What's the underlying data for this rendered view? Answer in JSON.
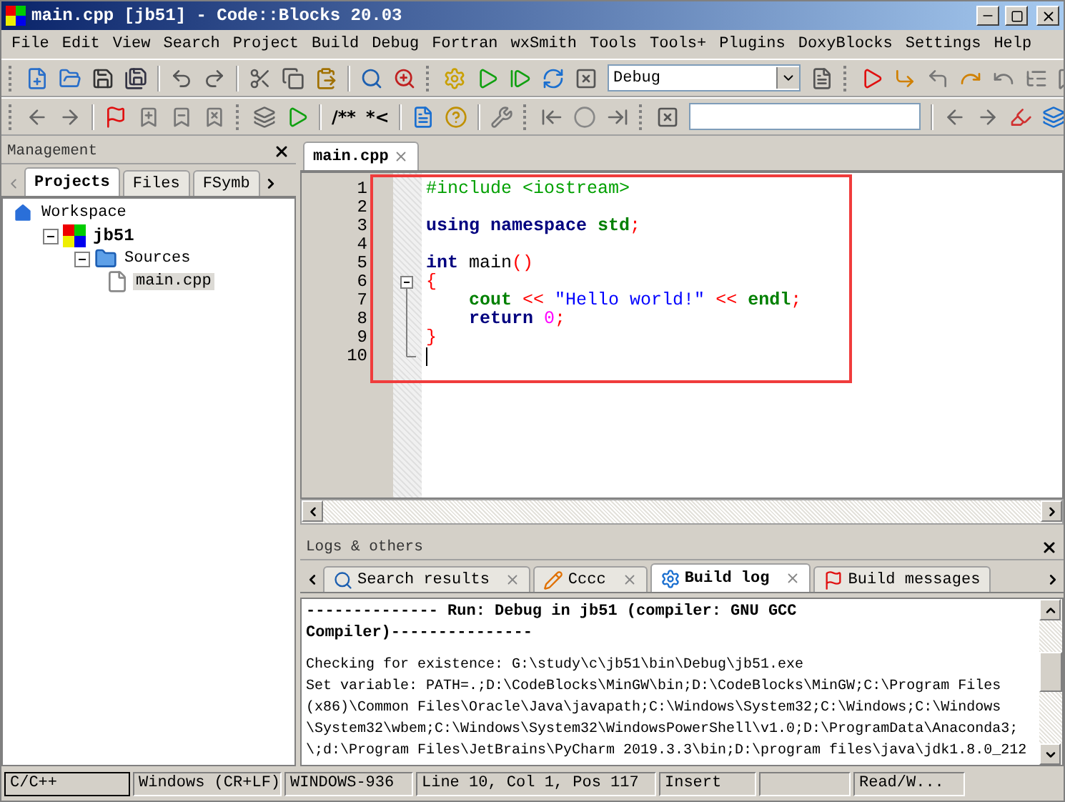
{
  "window": {
    "title": "main.cpp [jb51] - Code::Blocks 20.03"
  },
  "menu": [
    "File",
    "Edit",
    "View",
    "Search",
    "Project",
    "Build",
    "Debug",
    "Fortran",
    "wxSmith",
    "Tools",
    "Tools+",
    "Plugins",
    "DoxyBlocks",
    "Settings",
    "Help"
  ],
  "toolbar": {
    "build_target": "Debug",
    "doxy_block": "/**",
    "doxy_inline": "*<"
  },
  "management": {
    "title": "Management",
    "tabs": [
      {
        "label": "Projects",
        "selected": true
      },
      {
        "label": "Files",
        "selected": false
      },
      {
        "label": "FSymb",
        "selected": false
      }
    ],
    "tree": [
      {
        "label": "Workspace",
        "kind": "workspace",
        "expanded": true,
        "selected": false,
        "children": [
          {
            "label": "jb51",
            "kind": "project",
            "expanded": true,
            "selected": false,
            "children": [
              {
                "label": "Sources",
                "kind": "folder",
                "expanded": true,
                "selected": false,
                "children": [
                  {
                    "label": "main.cpp",
                    "kind": "file",
                    "selected": true
                  }
                ]
              }
            ]
          }
        ]
      }
    ]
  },
  "editor": {
    "tabs": [
      {
        "label": "main.cpp",
        "selected": true
      }
    ],
    "lines": [
      {
        "number": "1",
        "tokens": [
          {
            "kind": "preprocessor",
            "text": "#include <iostream>"
          }
        ]
      },
      {
        "number": "2"
      },
      {
        "number": "3",
        "tokens": [
          {
            "kind": "keyword",
            "text": "using"
          },
          {
            "kind": "keyword",
            "text": " namespace"
          },
          {
            "kind": "identifier",
            "text": " std"
          },
          {
            "kind": "operator",
            "text": ";"
          }
        ]
      },
      {
        "number": "4"
      },
      {
        "number": "5",
        "tokens": [
          {
            "kind": "keyword",
            "text": "int"
          },
          {
            "kind": "plain",
            "text": " main"
          },
          {
            "kind": "operator",
            "text": "()"
          }
        ]
      },
      {
        "number": "6",
        "tokens": [
          {
            "kind": "operator",
            "text": "{"
          }
        ]
      },
      {
        "number": "7",
        "tokens": [
          {
            "kind": "identifier",
            "text": "    cout"
          },
          {
            "kind": "operator",
            "text": " <<"
          },
          {
            "kind": "string",
            "text": " \"Hello world!\""
          },
          {
            "kind": "operator",
            "text": " <<"
          },
          {
            "kind": "identifier",
            "text": " endl"
          },
          {
            "kind": "operator",
            "text": ";"
          }
        ]
      },
      {
        "number": "8",
        "tokens": [
          {
            "kind": "keyword",
            "text": "    return"
          },
          {
            "kind": "number",
            "text": " 0"
          },
          {
            "kind": "operator",
            "text": ";"
          }
        ]
      },
      {
        "number": "9",
        "tokens": [
          {
            "kind": "operator",
            "text": "}"
          }
        ]
      },
      {
        "number": "10",
        "cursor": true
      }
    ]
  },
  "logs": {
    "title": "Logs & others",
    "tabs": [
      {
        "label": "Search results",
        "selected": false
      },
      {
        "label": "Cccc",
        "selected": false
      },
      {
        "label": "Build log",
        "selected": true
      },
      {
        "label": "Build messages",
        "selected": false
      }
    ],
    "lines": [
      {
        "text": "-------------- Run: Debug in jb51 (compiler: GNU GCC",
        "bold": true
      },
      {
        "text": "Compiler)---------------",
        "bold": true
      },
      {
        "text": "Checking for existence: G:\\study\\c\\jb51\\bin\\Debug\\jb51.exe",
        "bold": false
      },
      {
        "text": "Set variable: PATH=.;D:\\CodeBlocks\\MinGW\\bin;D:\\CodeBlocks\\MinGW;C:\\Program Files",
        "bold": false
      },
      {
        "text": "(x86)\\Common Files\\Oracle\\Java\\javapath;C:\\Windows\\System32;C:\\Windows;C:\\Windows",
        "bold": false
      },
      {
        "text": "\\System32\\wbem;C:\\Windows\\System32\\WindowsPowerShell\\v1.0;D:\\ProgramData\\Anaconda3;",
        "bold": false
      },
      {
        "text": "\\;d:\\Program Files\\JetBrains\\PyCharm 2019.3.3\\bin;D:\\program files\\java\\jdk1.8.0_212",
        "bold": false
      }
    ]
  },
  "status_bar": [
    "C/C++",
    "Windows (CR+LF)",
    "WINDOWS-936",
    "Line 10, Col 1, Pos 117",
    "Insert",
    "Read/W..."
  ]
}
